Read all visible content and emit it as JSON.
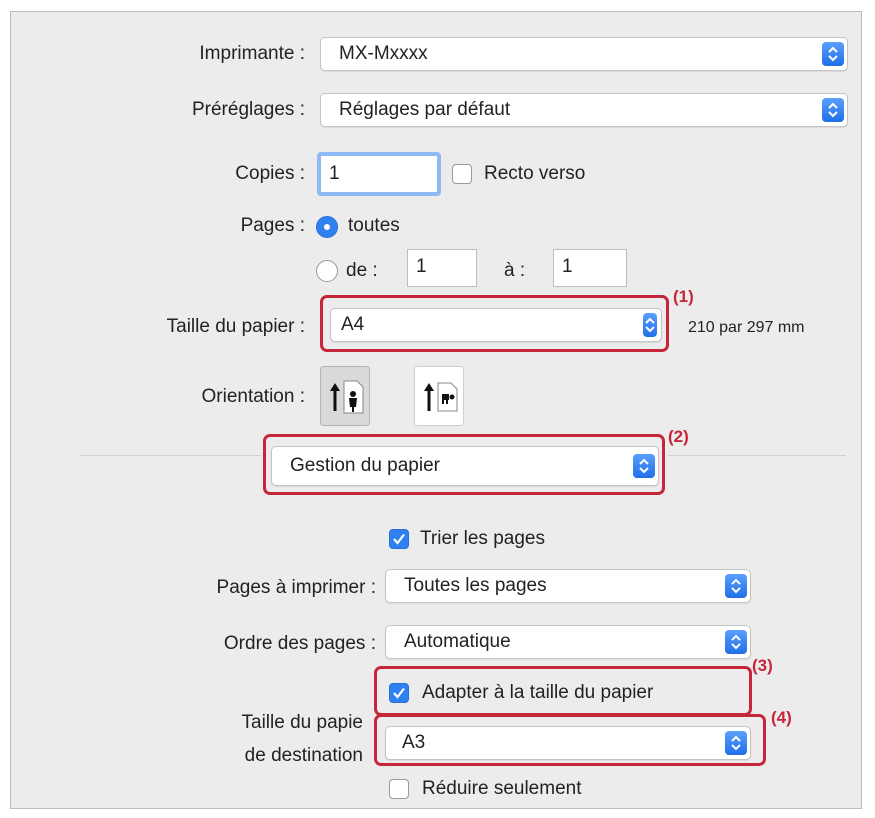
{
  "printer": {
    "label": "Imprimante :",
    "value": "MX-Mxxxx"
  },
  "presets": {
    "label": "Préréglages :",
    "value": "Réglages par défaut"
  },
  "copies": {
    "label": "Copies :",
    "value": "1",
    "duplex_label": "Recto verso",
    "duplex_checked": false
  },
  "pages": {
    "label": "Pages :",
    "all_label": "toutes",
    "all_selected": true,
    "from_label": "de :",
    "from_value": "1",
    "to_label": "à :",
    "to_value": "1"
  },
  "paper_size": {
    "label": "Taille du papier :",
    "value": "A4",
    "dimensions": "210 par 297 mm"
  },
  "orientation": {
    "label": "Orientation :",
    "options": [
      "portrait-icon",
      "landscape-icon"
    ],
    "selected": "portrait-icon"
  },
  "section": {
    "value": "Gestion du papier"
  },
  "collate": {
    "label": "Trier les pages",
    "checked": true
  },
  "pages_to_print": {
    "label": "Pages à imprimer :",
    "value": "Toutes les pages"
  },
  "page_order": {
    "label": "Ordre des pages :",
    "value": "Automatique"
  },
  "scale_to_fit": {
    "label": "Adapter à la taille du papier",
    "checked": true
  },
  "destination": {
    "label_line1": "Taille du papie",
    "label_line2": "de destination",
    "value": "A3"
  },
  "scale_down_only": {
    "label": "Réduire seulement",
    "checked": false
  },
  "callouts": {
    "c1": "(1)",
    "c2": "(2)",
    "c3": "(3)",
    "c4": "(4)"
  },
  "colors": {
    "highlight": "#c5263a",
    "accent": "#2f80f0",
    "background": "#ececec"
  }
}
